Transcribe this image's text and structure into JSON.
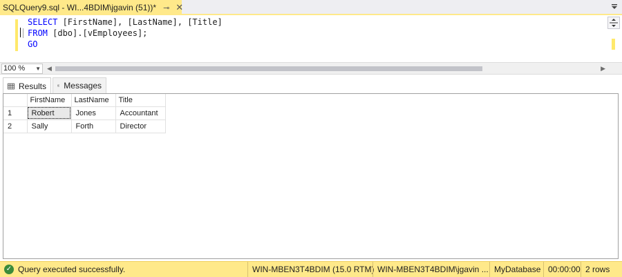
{
  "document_tab": {
    "title": "SQLQuery9.sql - WI...4BDIM\\jgavin (51))*",
    "pin_glyph": "⊸",
    "close_glyph": "✕"
  },
  "editor": {
    "lines": [
      {
        "kw1": "SELECT",
        "rest": " [FirstName], [LastName], [Title]"
      },
      {
        "kw1": "FROM",
        "rest": " [dbo].[vEmployees];"
      },
      {
        "kw1": "GO",
        "rest": ""
      }
    ]
  },
  "zoom": {
    "value": "100 %"
  },
  "results_tabs": {
    "results_label": "Results",
    "messages_label": "Messages"
  },
  "grid": {
    "columns": [
      "FirstName",
      "LastName",
      "Title"
    ],
    "rows": [
      {
        "num": "1",
        "FirstName": "Robert",
        "LastName": "Jones",
        "Title": "Accountant"
      },
      {
        "num": "2",
        "FirstName": "Sally",
        "LastName": "Forth",
        "Title": "Director"
      }
    ]
  },
  "status": {
    "message": "Query executed successfully.",
    "server": "WIN-MBEN3T4BDIM (15.0 RTM)",
    "user": "WIN-MBEN3T4BDIM\\jgavin ...",
    "database": "MyDatabase",
    "elapsed": "00:00:00",
    "rows": "2 rows"
  },
  "colors": {
    "accent_yellow": "#ffe98a",
    "keyword_blue": "#0000ff",
    "success_green": "#3b8b3b"
  }
}
